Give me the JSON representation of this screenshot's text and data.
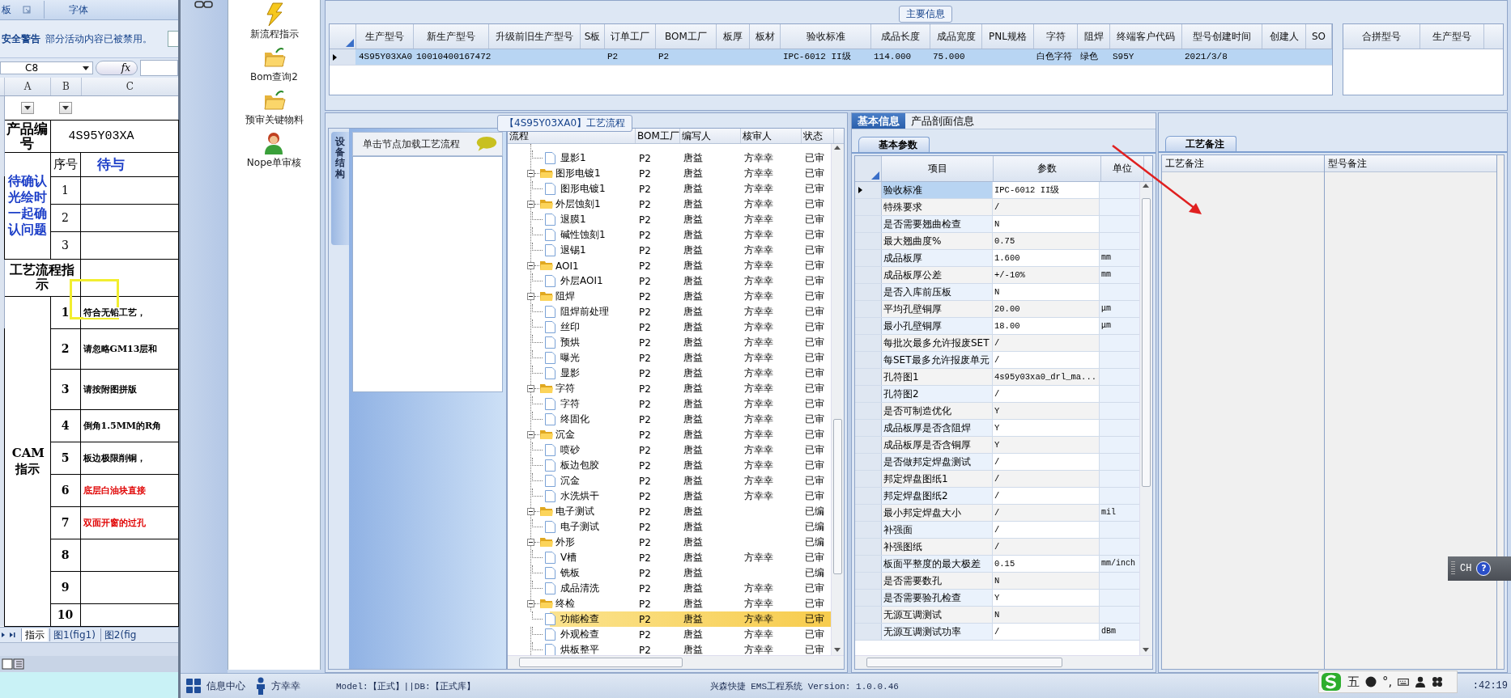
{
  "excel": {
    "ribbon_groups": [
      "板",
      "字体"
    ],
    "security_warning": {
      "title": "安全警告",
      "message": "部分活动内容已被禁用。"
    },
    "name_box": "C8",
    "formula_button": "fx",
    "column_headers": [
      "A",
      "B",
      "C"
    ],
    "product_label": "产品编号",
    "product_value": "4S95Y03XA",
    "pending_label": "待确认光绘时一起确认问题",
    "seq_header": "序号",
    "pending_header": "待与",
    "pending_rows": [
      "1",
      "2",
      "3"
    ],
    "process_label": "工艺流程指示",
    "cam_label": "CAM指示",
    "cam_rows": [
      {
        "no": "1",
        "text": "符合无铅工艺，",
        "color": "#000000"
      },
      {
        "no": "2",
        "text": "请忽略GM13层和",
        "color": "#000000"
      },
      {
        "no": "3",
        "text": "请按附图拼版",
        "color": "#000000"
      },
      {
        "no": "4",
        "text": "倒角1.5MM的R角",
        "color": "#000000"
      },
      {
        "no": "5",
        "text": "板边极限削铜，",
        "color": "#000000"
      },
      {
        "no": "6",
        "text": "底层白油块直接",
        "color": "#e00000"
      },
      {
        "no": "7",
        "text": "双面开窗的过孔",
        "color": "#e00000"
      },
      {
        "no": "8"
      },
      {
        "no": "9"
      },
      {
        "no": "10"
      }
    ],
    "sheet_tabs": [
      {
        "label": "指示",
        "selected": true
      },
      {
        "label": "图1(fig1)",
        "selected": false
      },
      {
        "label": "图2(fig",
        "selected": false
      }
    ]
  },
  "nav_items": [
    {
      "label": "新流程指示",
      "kind": "bolt"
    },
    {
      "label": "Bom查询2",
      "kind": "folder"
    },
    {
      "label": "预审关键物料",
      "kind": "folder"
    },
    {
      "label": "Nope单审核",
      "kind": "user"
    }
  ],
  "main_info": {
    "title": "主要信息",
    "columns": [
      "生产型号",
      "新生产型号",
      "升级前旧生产型号",
      "S板",
      "订单工厂",
      "BOM工厂",
      "板厚",
      "板材",
      "验收标准",
      "成品长度",
      "成品宽度",
      "PNL规格",
      "字符",
      "阻焊",
      "终端客户代码",
      "型号创建时间",
      "创建人",
      "SO"
    ],
    "rows": [
      {
        "selected": true,
        "cells": [
          "4S95Y03XA0",
          "10010400167472",
          null,
          null,
          "P2",
          "P2",
          null,
          null,
          "IPC-6012 II级",
          "114.000",
          "75.000",
          null,
          "白色字符",
          "绿色",
          "S95Y",
          "2021/3/8",
          null,
          null
        ]
      }
    ],
    "merge_columns": [
      "合拼型号",
      "生产型号"
    ]
  },
  "flow": {
    "title": "【4S95Y03XA0】工艺流程",
    "side_tab": "设备结构",
    "hint": "单击节点加载工艺流程",
    "columns": [
      "流程",
      "BOM工厂",
      "编写人",
      "核审人",
      "状态"
    ],
    "tree": [
      {
        "children": [
          {
            "name": "显影1",
            "bom": "P2",
            "writer": "唐益",
            "reviewer": "方幸幸",
            "status": "已审",
            "selected": false
          }
        ]
      },
      {
        "name": "图形电镀1",
        "bom": "P2",
        "writer": "唐益",
        "reviewer": "方幸幸",
        "status": "已审",
        "selected": false,
        "expanded": true,
        "children": [
          {
            "name": "图形电镀1",
            "bom": "P2",
            "writer": "唐益",
            "reviewer": "方幸幸",
            "status": "已审",
            "selected": false
          }
        ]
      },
      {
        "name": "外层蚀刻1",
        "bom": "P2",
        "writer": "唐益",
        "reviewer": "方幸幸",
        "status": "已审",
        "selected": false,
        "expanded": true,
        "children": [
          {
            "name": "退膜1",
            "bom": "P2",
            "writer": "唐益",
            "reviewer": "方幸幸",
            "status": "已审",
            "selected": false
          },
          {
            "name": "碱性蚀刻1",
            "bom": "P2",
            "writer": "唐益",
            "reviewer": "方幸幸",
            "status": "已审",
            "selected": false
          },
          {
            "name": "退锡1",
            "bom": "P2",
            "writer": "唐益",
            "reviewer": "方幸幸",
            "status": "已审",
            "selected": false
          }
        ]
      },
      {
        "name": "AOI1",
        "bom": "P2",
        "writer": "唐益",
        "reviewer": "方幸幸",
        "status": "已审",
        "selected": false,
        "expanded": true,
        "children": [
          {
            "name": "外层AOI1",
            "bom": "P2",
            "writer": "唐益",
            "reviewer": "方幸幸",
            "status": "已审",
            "selected": false
          }
        ]
      },
      {
        "name": "阻焊",
        "bom": "P2",
        "writer": "唐益",
        "reviewer": "方幸幸",
        "status": "已审",
        "selected": false,
        "expanded": true,
        "children": [
          {
            "name": "阻焊前处理",
            "bom": "P2",
            "writer": "唐益",
            "reviewer": "方幸幸",
            "status": "已审",
            "selected": false
          },
          {
            "name": "丝印",
            "bom": "P2",
            "writer": "唐益",
            "reviewer": "方幸幸",
            "status": "已审",
            "selected": false
          },
          {
            "name": "预烘",
            "bom": "P2",
            "writer": "唐益",
            "reviewer": "方幸幸",
            "status": "已审",
            "selected": false
          },
          {
            "name": "曝光",
            "bom": "P2",
            "writer": "唐益",
            "reviewer": "方幸幸",
            "status": "已审",
            "selected": false
          },
          {
            "name": "显影",
            "bom": "P2",
            "writer": "唐益",
            "reviewer": "方幸幸",
            "status": "已审",
            "selected": false
          }
        ]
      },
      {
        "name": "字符",
        "bom": "P2",
        "writer": "唐益",
        "reviewer": "方幸幸",
        "status": "已审",
        "selected": false,
        "expanded": true,
        "children": [
          {
            "name": "字符",
            "bom": "P2",
            "writer": "唐益",
            "reviewer": "方幸幸",
            "status": "已审",
            "selected": false
          },
          {
            "name": "终固化",
            "bom": "P2",
            "writer": "唐益",
            "reviewer": "方幸幸",
            "status": "已审",
            "selected": false
          }
        ]
      },
      {
        "name": "沉金",
        "bom": "P2",
        "writer": "唐益",
        "reviewer": "方幸幸",
        "status": "已审",
        "selected": false,
        "expanded": true,
        "children": [
          {
            "name": "喷砂",
            "bom": "P2",
            "writer": "唐益",
            "reviewer": "方幸幸",
            "status": "已审",
            "selected": false
          },
          {
            "name": "板边包胶",
            "bom": "P2",
            "writer": "唐益",
            "reviewer": "方幸幸",
            "status": "已审",
            "selected": false
          },
          {
            "name": "沉金",
            "bom": "P2",
            "writer": "唐益",
            "reviewer": "方幸幸",
            "status": "已审",
            "selected": false
          },
          {
            "name": "水洗烘干",
            "bom": "P2",
            "writer": "唐益",
            "reviewer": "方幸幸",
            "status": "已审",
            "selected": false
          }
        ]
      },
      {
        "name": "电子测试",
        "bom": "P2",
        "writer": "唐益",
        "status": "已编",
        "selected": false,
        "expanded": true,
        "children": [
          {
            "name": "电子测试",
            "bom": "P2",
            "writer": "唐益",
            "status": "已编",
            "selected": false
          }
        ]
      },
      {
        "name": "外形",
        "bom": "P2",
        "writer": "唐益",
        "status": "已编",
        "selected": false,
        "expanded": true,
        "children": [
          {
            "name": "V槽",
            "bom": "P2",
            "writer": "唐益",
            "reviewer": "方幸幸",
            "status": "已审",
            "selected": false
          },
          {
            "name": "铣板",
            "bom": "P2",
            "writer": "唐益",
            "status": "已编",
            "selected": false
          },
          {
            "name": "成品清洗",
            "bom": "P2",
            "writer": "唐益",
            "reviewer": "方幸幸",
            "status": "已审",
            "selected": false
          }
        ]
      },
      {
        "name": "终检",
        "bom": "P2",
        "writer": "唐益",
        "reviewer": "方幸幸",
        "status": "已审",
        "selected": false,
        "expanded": true,
        "children": [
          {
            "name": "功能检查",
            "bom": "P2",
            "writer": "唐益",
            "reviewer": "方幸幸",
            "status": "已审",
            "selected": true
          },
          {
            "name": "外观检查",
            "bom": "P2",
            "writer": "唐益",
            "reviewer": "方幸幸",
            "status": "已审",
            "selected": false
          },
          {
            "name": "烘板整平",
            "bom": "P2",
            "writer": "唐益",
            "reviewer": "方幸幸",
            "status": "已审",
            "selected": false
          }
        ]
      }
    ]
  },
  "basic": {
    "tabs": [
      {
        "label": "基本信息",
        "selected": true
      },
      {
        "label": "产品剖面信息",
        "selected": false
      }
    ],
    "sub_tab": "基本参数",
    "columns": [
      "项目",
      "参数",
      "单位"
    ],
    "rows": [
      {
        "item": "验收标准",
        "value": "IPC-6012 II级",
        "selected": true
      },
      {
        "item": "特殊要求",
        "value": "/",
        "selected": false
      },
      {
        "item": "是否需要翘曲检查",
        "value": "N",
        "selected": false
      },
      {
        "item": "最大翘曲度%",
        "value": "0.75",
        "selected": false
      },
      {
        "item": "成品板厚",
        "value": "1.600",
        "unit": "mm",
        "selected": false
      },
      {
        "item": "成品板厚公差",
        "value": "+/-10%",
        "unit": "mm",
        "selected": false
      },
      {
        "item": "是否入库前压板",
        "value": "N",
        "selected": false
      },
      {
        "item": "平均孔壁铜厚",
        "value": "20.00",
        "unit": "μm",
        "selected": false
      },
      {
        "item": "最小孔壁铜厚",
        "value": "18.00",
        "unit": "μm",
        "selected": false
      },
      {
        "item": "每批次最多允许报废SET",
        "value": "/",
        "selected": false
      },
      {
        "item": "每SET最多允许报废单元",
        "value": "/",
        "selected": false
      },
      {
        "item": "孔符图1",
        "value": "4s95y03xa0_drl_ma...",
        "selected": false
      },
      {
        "item": "孔符图2",
        "value": "/",
        "selected": false
      },
      {
        "item": "是否可制造优化",
        "value": "Y",
        "selected": false
      },
      {
        "item": "成品板厚是否含阻焊",
        "value": "Y",
        "selected": false
      },
      {
        "item": "成品板厚是否含铜厚",
        "value": "Y",
        "selected": false
      },
      {
        "item": "是否做邦定焊盘测试",
        "value": "/",
        "selected": false
      },
      {
        "item": "邦定焊盘图纸1",
        "value": "/",
        "selected": false
      },
      {
        "item": "邦定焊盘图纸2",
        "value": "/",
        "selected": false
      },
      {
        "item": "最小邦定焊盘大小",
        "value": "/",
        "unit": "mil",
        "selected": false
      },
      {
        "item": "补强面",
        "value": "/",
        "selected": false
      },
      {
        "item": "补强图纸",
        "value": "/",
        "selected": false
      },
      {
        "item": "板面平整度的最大极差",
        "value": "0.15",
        "unit": "mm/inch",
        "selected": false
      },
      {
        "item": "是否需要数孔",
        "value": "N",
        "selected": false
      },
      {
        "item": "是否需要验孔检查",
        "value": "Y",
        "selected": false
      },
      {
        "item": "无源互调测试",
        "value": "N",
        "selected": false
      },
      {
        "item": "无源互调测试功率",
        "value": "/",
        "unit": "dBm",
        "selected": false
      }
    ]
  },
  "notes": {
    "tab": "工艺备注",
    "columns": [
      "工艺备注",
      "型号备注"
    ]
  },
  "status_bar": {
    "info_center": "信息中心",
    "user": "方幸幸",
    "model": "Model:【正式】||DB:【正式库】",
    "version": "兴森快捷 EMS工程系统 Version: 1.0.0.46",
    "clock": ":42:19"
  },
  "ime_bar": {
    "language": "CH",
    "help": "?"
  },
  "ime_toolbar": {
    "mode": "五",
    "punctuation": "°,"
  }
}
